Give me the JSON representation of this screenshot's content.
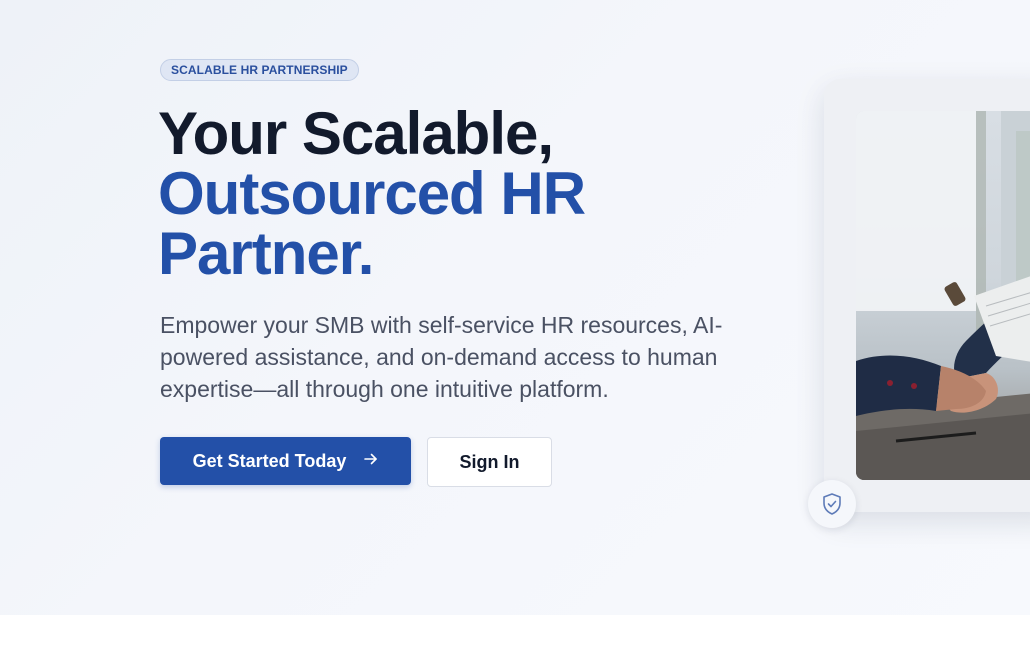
{
  "hero": {
    "badge": "SCALABLE HR PARTNERSHIP",
    "headline_line1": "Your Scalable,",
    "headline_line2": "Outsourced HR",
    "headline_line3": "Partner.",
    "description": "Empower your SMB with self-service HR resources, AI-powered assistance, and on-demand access to human expertise—all through one intuitive platform.",
    "primary_button": "Get Started Today",
    "primary_button_icon": "arrow-right-icon",
    "secondary_button": "Sign In",
    "image_icon": "shield-check-icon"
  },
  "colors": {
    "accent": "#2350a8",
    "heading": "#121a2c",
    "body_text": "#4a5163",
    "background": "#f4f6fb"
  }
}
